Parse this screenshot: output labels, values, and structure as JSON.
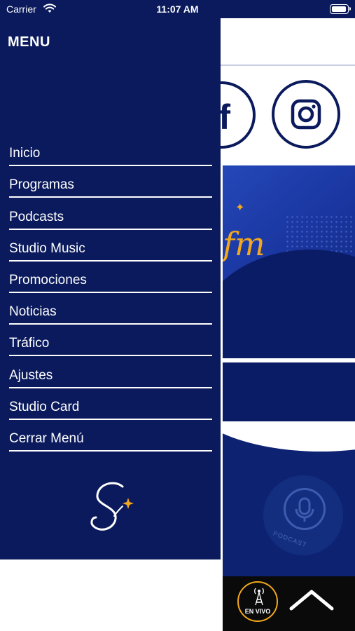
{
  "status_bar": {
    "carrier": "Carrier",
    "time": "11:07 AM",
    "battery_level": 1.0
  },
  "menu": {
    "title": "MENU",
    "items": [
      {
        "label": "Inicio"
      },
      {
        "label": "Programas"
      },
      {
        "label": "Podcasts"
      },
      {
        "label": "Studio Music"
      },
      {
        "label": "Promociones"
      },
      {
        "label": "Noticias"
      },
      {
        "label": "Tráfico"
      },
      {
        "label": "Ajustes"
      },
      {
        "label": "Studio Card"
      },
      {
        "label": "Cerrar Menú"
      }
    ],
    "logo_icon": "studio-s-logo-icon"
  },
  "background_app": {
    "social_icons": [
      "facebook-icon",
      "instagram-icon"
    ],
    "banner_text": "fm",
    "podcast_label": "PODCAST",
    "player": {
      "live_label": "EN VIVO",
      "live_icon": "radio-tower-icon",
      "expand_icon": "chevron-up-icon"
    }
  },
  "colors": {
    "menu_background": "#0a1a5c",
    "accent_gold": "#f2a81d",
    "player_background": "#0a0a0a"
  }
}
